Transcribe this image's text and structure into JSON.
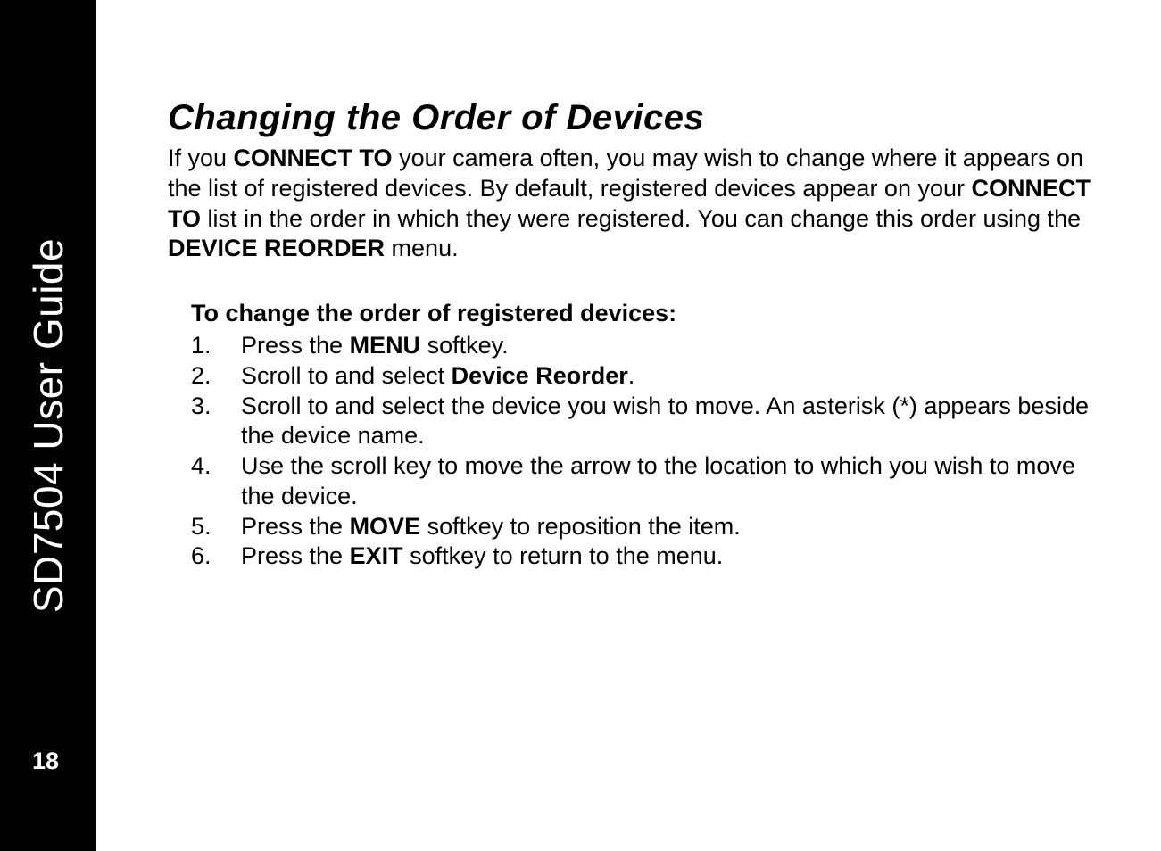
{
  "sidebar": {
    "title": "SD7504 User Guide",
    "page_number": "18"
  },
  "heading": "Changing the Order of Devices",
  "intro": {
    "t1": "If you ",
    "connect_to_1": "CONNECT TO",
    "t2": " your camera often, you may wish to change where it appears on the list of registered devices. By default, registered devices appear on your ",
    "connect_to_2": "CONNECT TO",
    "t3": " list in the order in which they were registered. You can change this order using the ",
    "device_reorder": "DEVICE REORDER",
    "t4": " menu."
  },
  "subheading": "To change the order of registered devices:",
  "steps": {
    "n1": "1.",
    "s1a": "Press the ",
    "s1_menu": "MENU",
    "s1b": " softkey.",
    "n2": "2.",
    "s2a": "Scroll to and select ",
    "s2_dr": "Device Reorder",
    "s2b": ".",
    "n3": "3.",
    "s3": "Scroll to and select the device you wish to move. An asterisk (*) appears beside the device name.",
    "n4": "4.",
    "s4": "Use the scroll key to move the arrow to the location to which you wish to move the device.",
    "n5": "5.",
    "s5a": "Press the ",
    "s5_move": "MOVE",
    "s5b": " softkey to reposition the item.",
    "n6": "6.",
    "s6a": "Press the ",
    "s6_exit": "EXIT",
    "s6b": " softkey to return to the menu."
  }
}
